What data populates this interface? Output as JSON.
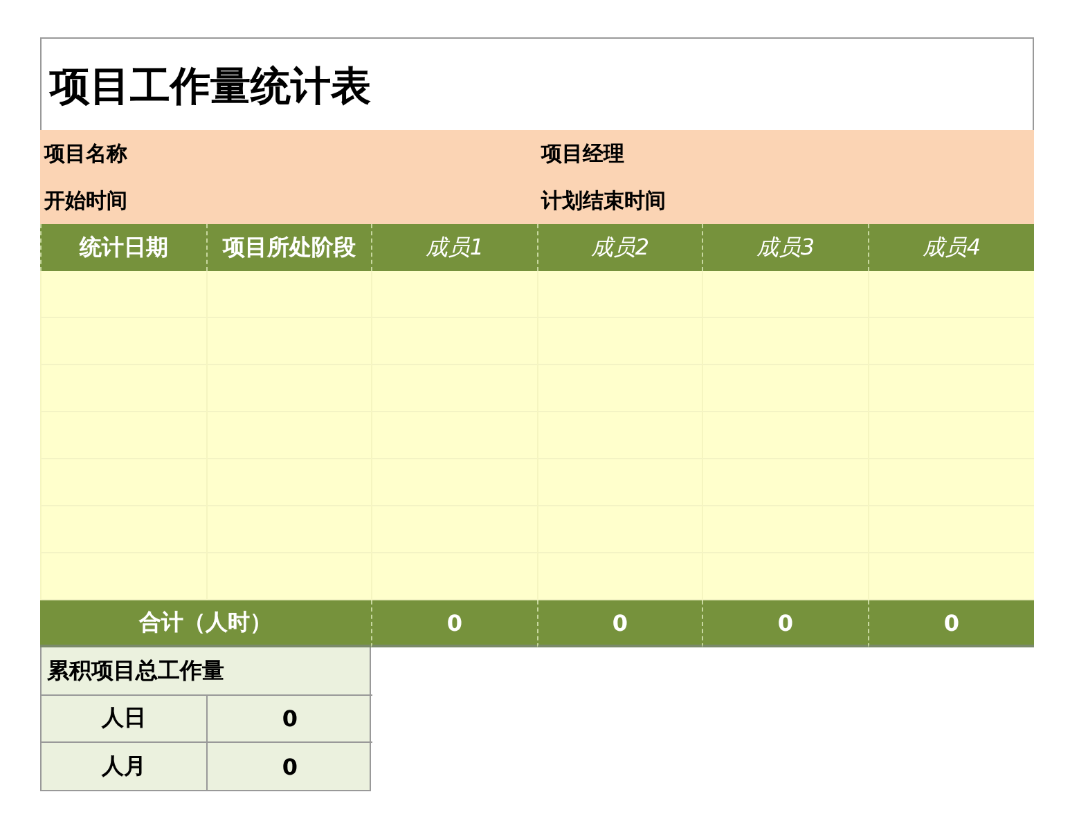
{
  "title": "项目工作量统计表",
  "info": [
    {
      "left": "项目名称",
      "right": "项目经理"
    },
    {
      "left": "开始时间",
      "right": "计划结束时间"
    }
  ],
  "columns": [
    {
      "label": "统计日期",
      "italic": false
    },
    {
      "label": "项目所处阶段",
      "italic": false
    },
    {
      "label": "成员1",
      "italic": true
    },
    {
      "label": "成员2",
      "italic": true
    },
    {
      "label": "成员3",
      "italic": true
    },
    {
      "label": "成员4",
      "italic": true
    }
  ],
  "total": {
    "label": "合计（人时）",
    "values": [
      "0",
      "0",
      "0",
      "0"
    ]
  },
  "cumulative": {
    "title": "累积项目总工作量",
    "rows": [
      {
        "label": "人日",
        "value": "0"
      },
      {
        "label": "人月",
        "value": "0"
      }
    ]
  }
}
